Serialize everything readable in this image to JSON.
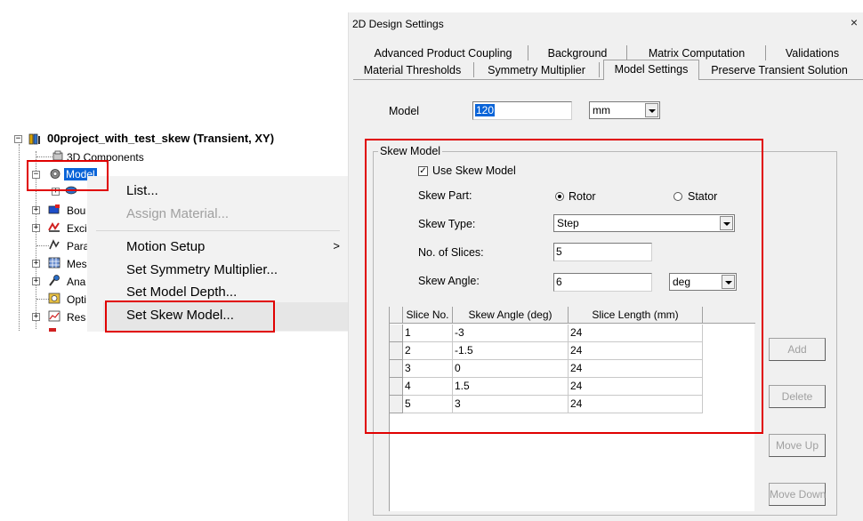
{
  "tree": {
    "root_label": "00project_with_test_skew (Transient, XY)",
    "items": [
      {
        "label": "3D Components"
      },
      {
        "label": "Model"
      },
      {
        "label": "Bou"
      },
      {
        "label": "Exci"
      },
      {
        "label": "Para"
      },
      {
        "label": "Mes"
      },
      {
        "label": "Ana"
      },
      {
        "label": "Opti"
      },
      {
        "label": "Res"
      }
    ]
  },
  "context_menu": {
    "items": [
      {
        "label": "List...",
        "enabled": true
      },
      {
        "label": "Assign Material...",
        "enabled": false
      },
      {
        "label": "Motion Setup",
        "enabled": true,
        "submenu": true
      },
      {
        "label": "Set Symmetry Multiplier...",
        "enabled": true
      },
      {
        "label": "Set Model Depth...",
        "enabled": true
      },
      {
        "label": "Set Skew Model...",
        "enabled": true,
        "hovered": true
      }
    ],
    "submenu_arrow": ">"
  },
  "dialog": {
    "title": "2D Design Settings",
    "close": "×",
    "tabs_row1": [
      "Advanced Product Coupling",
      "Background",
      "Matrix Computation",
      "Validations"
    ],
    "tabs_row2": [
      "Material Thresholds",
      "Symmetry Multiplier",
      "Model Settings",
      "Preserve Transient Solution"
    ],
    "active_tab": "Model Settings",
    "model": {
      "label": "Model",
      "value": "120",
      "unit": "mm"
    },
    "skew_model": {
      "group_title": "Skew Model",
      "use_skew_label": "Use Skew Model",
      "use_skew_checked": true,
      "check_mark": "✓",
      "skew_part_label": "Skew Part:",
      "rotor_label": "Rotor",
      "stator_label": "Stator",
      "selected_part": "Rotor",
      "skew_type_label": "Skew Type:",
      "skew_type_value": "Step",
      "slices_label": "No. of Slices:",
      "slices_value": "5",
      "angle_label": "Skew Angle:",
      "angle_value": "6",
      "angle_unit": "deg"
    },
    "table": {
      "headers": [
        "Slice No.",
        "Skew Angle (deg)",
        "Slice Length (mm)"
      ],
      "rows": [
        [
          "1",
          "-3",
          "24"
        ],
        [
          "2",
          "-1.5",
          "24"
        ],
        [
          "3",
          "0",
          "24"
        ],
        [
          "4",
          "1.5",
          "24"
        ],
        [
          "5",
          "3",
          "24"
        ]
      ]
    },
    "buttons": {
      "add": "Add",
      "delete": "Delete",
      "move_up": "Move Up",
      "move_down": "Move Down"
    }
  },
  "colors": {
    "highlight_red": "#e00000",
    "selection_blue": "#0a64d8"
  }
}
